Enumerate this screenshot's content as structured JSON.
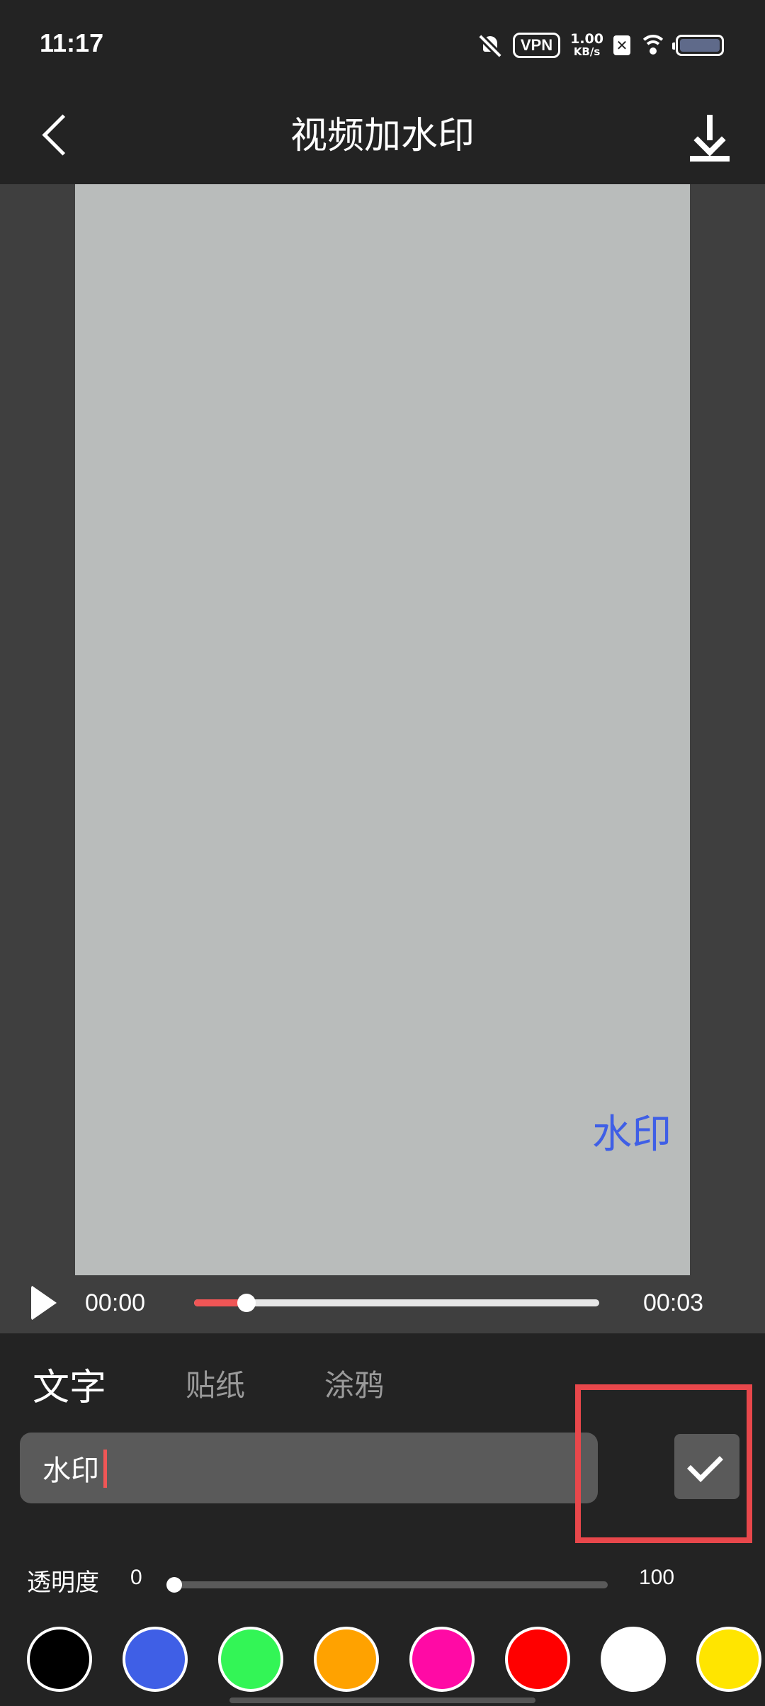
{
  "status_bar": {
    "time": "11:17",
    "vpn_label": "VPN",
    "speed_value": "1.00",
    "speed_unit": "KB/s",
    "x_badge": "✕",
    "icons": [
      "bell-off-icon",
      "vpn-icon",
      "x-app-icon",
      "wifi-icon",
      "battery-icon"
    ]
  },
  "header": {
    "title": "视频加水印",
    "back_icon": "chevron-left-icon",
    "download_icon": "download-icon"
  },
  "preview": {
    "watermark_text": "水印",
    "watermark_color": "#3f5fe6"
  },
  "player": {
    "current_time": "00:00",
    "total_time": "00:03",
    "progress": 0.13,
    "play_icon": "play-icon",
    "accent_color": "#f05656"
  },
  "tabs": [
    {
      "label": "文字",
      "active": true
    },
    {
      "label": "贴纸",
      "active": false
    },
    {
      "label": "涂鸦",
      "active": false
    }
  ],
  "text_input": {
    "value": "水印",
    "confirm_icon": "check-icon"
  },
  "opacity": {
    "label": "透明度",
    "min": "0",
    "max": "100",
    "value": 0
  },
  "palette": {
    "colors": [
      "#000000",
      "#3f5fe6",
      "#33f556",
      "#ffa200",
      "#ff0aa5",
      "#ff0000",
      "#ffffff",
      "#ffe500"
    ]
  }
}
